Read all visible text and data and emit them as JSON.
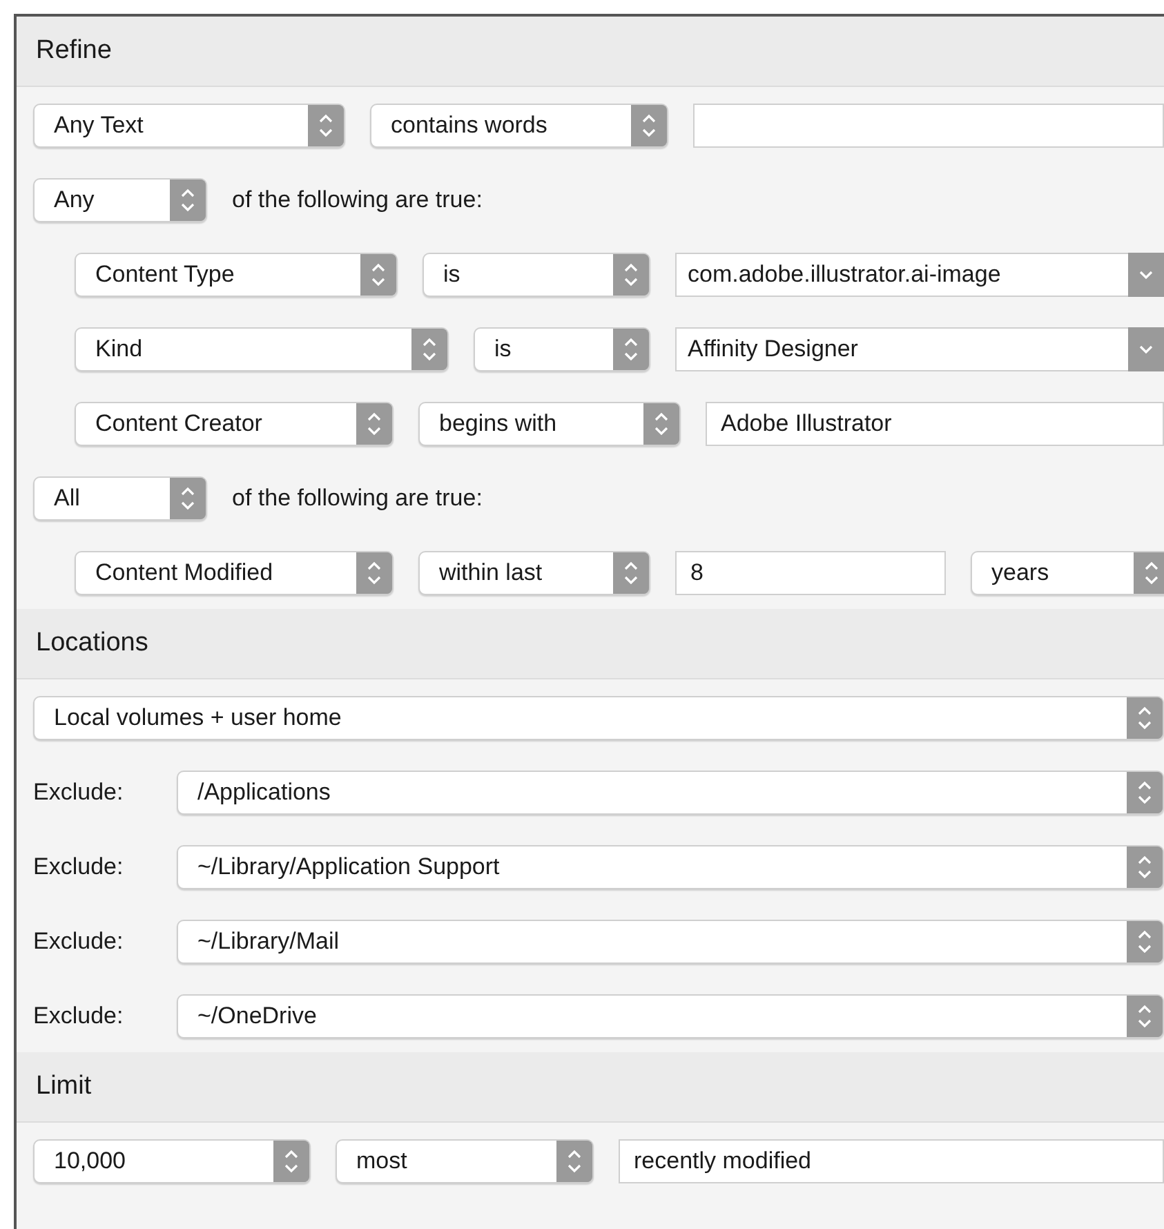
{
  "sections": [
    {
      "title": "Refine",
      "rows": [
        {
          "controls": [
            {
              "kind": "popup",
              "value": "Any Text"
            },
            {
              "kind": "popup",
              "value": "contains words"
            },
            {
              "kind": "field"
            }
          ]
        },
        {
          "controls": [
            {
              "kind": "popup",
              "value": "Any"
            },
            {
              "kind": "label",
              "text": "of the following are true:"
            }
          ],
          "children": [
            {
              "controls": [
                {
                  "kind": "popup",
                  "value": "Content Type"
                },
                {
                  "kind": "popup",
                  "value": "is"
                },
                {
                  "kind": "combo",
                  "value": "com.adobe.illustrator.ai-image"
                }
              ]
            },
            {
              "controls": [
                {
                  "kind": "popup",
                  "value": "Kind"
                },
                {
                  "kind": "popup",
                  "value": "is"
                },
                {
                  "kind": "combo",
                  "value": "Affinity Designer"
                }
              ]
            },
            {
              "controls": [
                {
                  "kind": "popup",
                  "value": "Content Creator"
                },
                {
                  "kind": "popup",
                  "value": "begins with"
                },
                {
                  "kind": "field",
                  "value": "Adobe Illustrator"
                }
              ]
            }
          ]
        },
        {
          "controls": [
            {
              "kind": "popup",
              "value": "All"
            },
            {
              "kind": "label",
              "text": "of the following are true:"
            }
          ],
          "children": [
            {
              "controls": [
                {
                  "kind": "popup",
                  "value": "Content Modified"
                },
                {
                  "kind": "popup",
                  "value": "within last"
                },
                {
                  "kind": "field",
                  "value": "8"
                },
                {
                  "kind": "popup",
                  "value": "years"
                }
              ]
            }
          ]
        }
      ]
    },
    {
      "title": "Locations",
      "rows": [
        {
          "controls": [
            {
              "kind": "popup",
              "value": "Local volumes + user home"
            }
          ]
        },
        {
          "controls": [
            {
              "kind": "label",
              "text": "Exclude:"
            },
            {
              "kind": "popup",
              "value": "/Applications"
            }
          ]
        },
        {
          "controls": [
            {
              "kind": "label",
              "text": "Exclude:"
            },
            {
              "kind": "popup",
              "value": "~/Library/Application Support"
            }
          ]
        },
        {
          "controls": [
            {
              "kind": "label",
              "text": "Exclude:"
            },
            {
              "kind": "popup",
              "value": "~/Library/Mail"
            }
          ]
        },
        {
          "controls": [
            {
              "kind": "label",
              "text": "Exclude:"
            },
            {
              "kind": "popup",
              "value": "~/OneDrive"
            }
          ]
        }
      ]
    },
    {
      "title": "Limit",
      "rows": [
        {
          "controls": [
            {
              "kind": "popup",
              "value": "10,000"
            },
            {
              "kind": "popup",
              "value": "most"
            },
            {
              "kind": "field",
              "value": "recently modified"
            }
          ]
        }
      ]
    }
  ]
}
